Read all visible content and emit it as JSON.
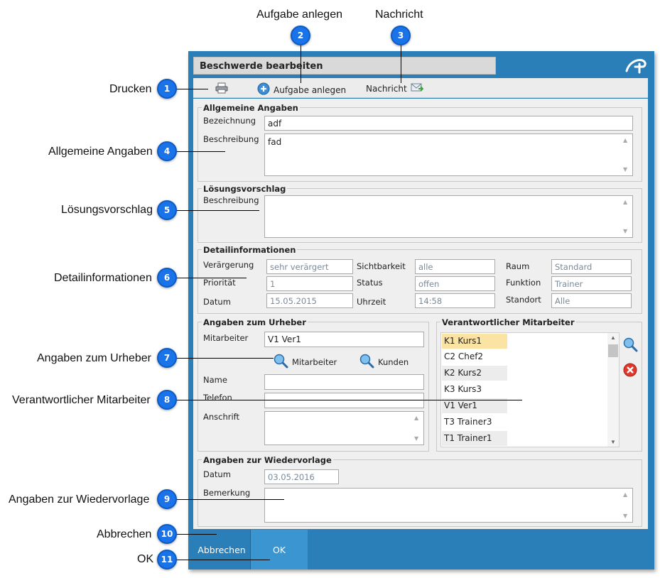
{
  "callouts": {
    "drucken": "Drucken",
    "aufgabe": "Aufgabe anlegen",
    "nachricht": "Nachricht",
    "allgemein": "Allgemeine Angaben",
    "loesung": "Lösungsvorschlag",
    "detail": "Detailinformationen",
    "urheber": "Angaben zum Urheber",
    "verantwortlich": "Verantwortlicher Mitarbeiter",
    "wiedervorlage": "Angaben zur Wiedervorlage",
    "abbrechen": "Abbrechen",
    "ok": "OK"
  },
  "badges": [
    "1",
    "2",
    "3",
    "4",
    "5",
    "6",
    "7",
    "8",
    "9",
    "10",
    "11"
  ],
  "dialog": {
    "title": "Beschwerde bearbeiten",
    "accent_color": "#2a7fb8",
    "badge_color": "#1a73e8",
    "logo_icon": "app-logo-icon"
  },
  "toolbar": {
    "print_icon": "printer-icon",
    "task_label": "Aufgabe anlegen",
    "task_icon": "add-task-icon",
    "message_label": "Nachricht",
    "message_icon": "envelope-icon"
  },
  "allgemein": {
    "legend": "Allgemeine Angaben",
    "bezeichnung_label": "Bezeichnung",
    "bezeichnung_value": "adf",
    "beschreibung_label": "Beschreibung",
    "beschreibung_value": "fad"
  },
  "loesung": {
    "legend": "Lösungsvorschlag",
    "beschreibung_label": "Beschreibung",
    "beschreibung_value": ""
  },
  "detail": {
    "legend": "Detailinformationen",
    "veraergerung_label": "Verärgerung",
    "veraergerung_value": "sehr verärgert",
    "prioritaet_label": "Priorität",
    "prioritaet_value": "1",
    "datum_label": "Datum",
    "datum_value": "15.05.2015",
    "sichtbarkeit_label": "Sichtbarkeit",
    "sichtbarkeit_value": "alle",
    "status_label": "Status",
    "status_value": "offen",
    "uhrzeit_label": "Uhrzeit",
    "uhrzeit_value": "14:58",
    "raum_label": "Raum",
    "raum_value": "Standard",
    "funktion_label": "Funktion",
    "funktion_value": "Trainer",
    "standort_label": "Standort",
    "standort_value": "Alle"
  },
  "urheber": {
    "legend": "Angaben zum Urheber",
    "mitarbeiter_label": "Mitarbeiter",
    "mitarbeiter_value": "V1 Ver1",
    "search_mitarbeiter": "Mitarbeiter",
    "search_kunden": "Kunden",
    "name_label": "Name",
    "name_value": "",
    "telefon_label": "Telefon",
    "telefon_value": "",
    "anschrift_label": "Anschrift",
    "anschrift_value": ""
  },
  "verantwortlich": {
    "legend": "Verantwortlicher Mitarbeiter",
    "items": [
      "K1 Kurs1",
      "C2 Chef2",
      "K2 Kurs2",
      "K3 Kurs3",
      "V1 Ver1",
      "T3 Trainer3",
      "T1 Trainer1"
    ],
    "selected": "K1 Kurs1"
  },
  "wiedervorlage": {
    "legend": "Angaben zur Wiedervorlage",
    "datum_label": "Datum",
    "datum_value": "03.05.2016",
    "bemerkung_label": "Bemerkung",
    "bemerkung_value": ""
  },
  "buttons": {
    "cancel": "Abbrechen",
    "ok": "OK"
  }
}
